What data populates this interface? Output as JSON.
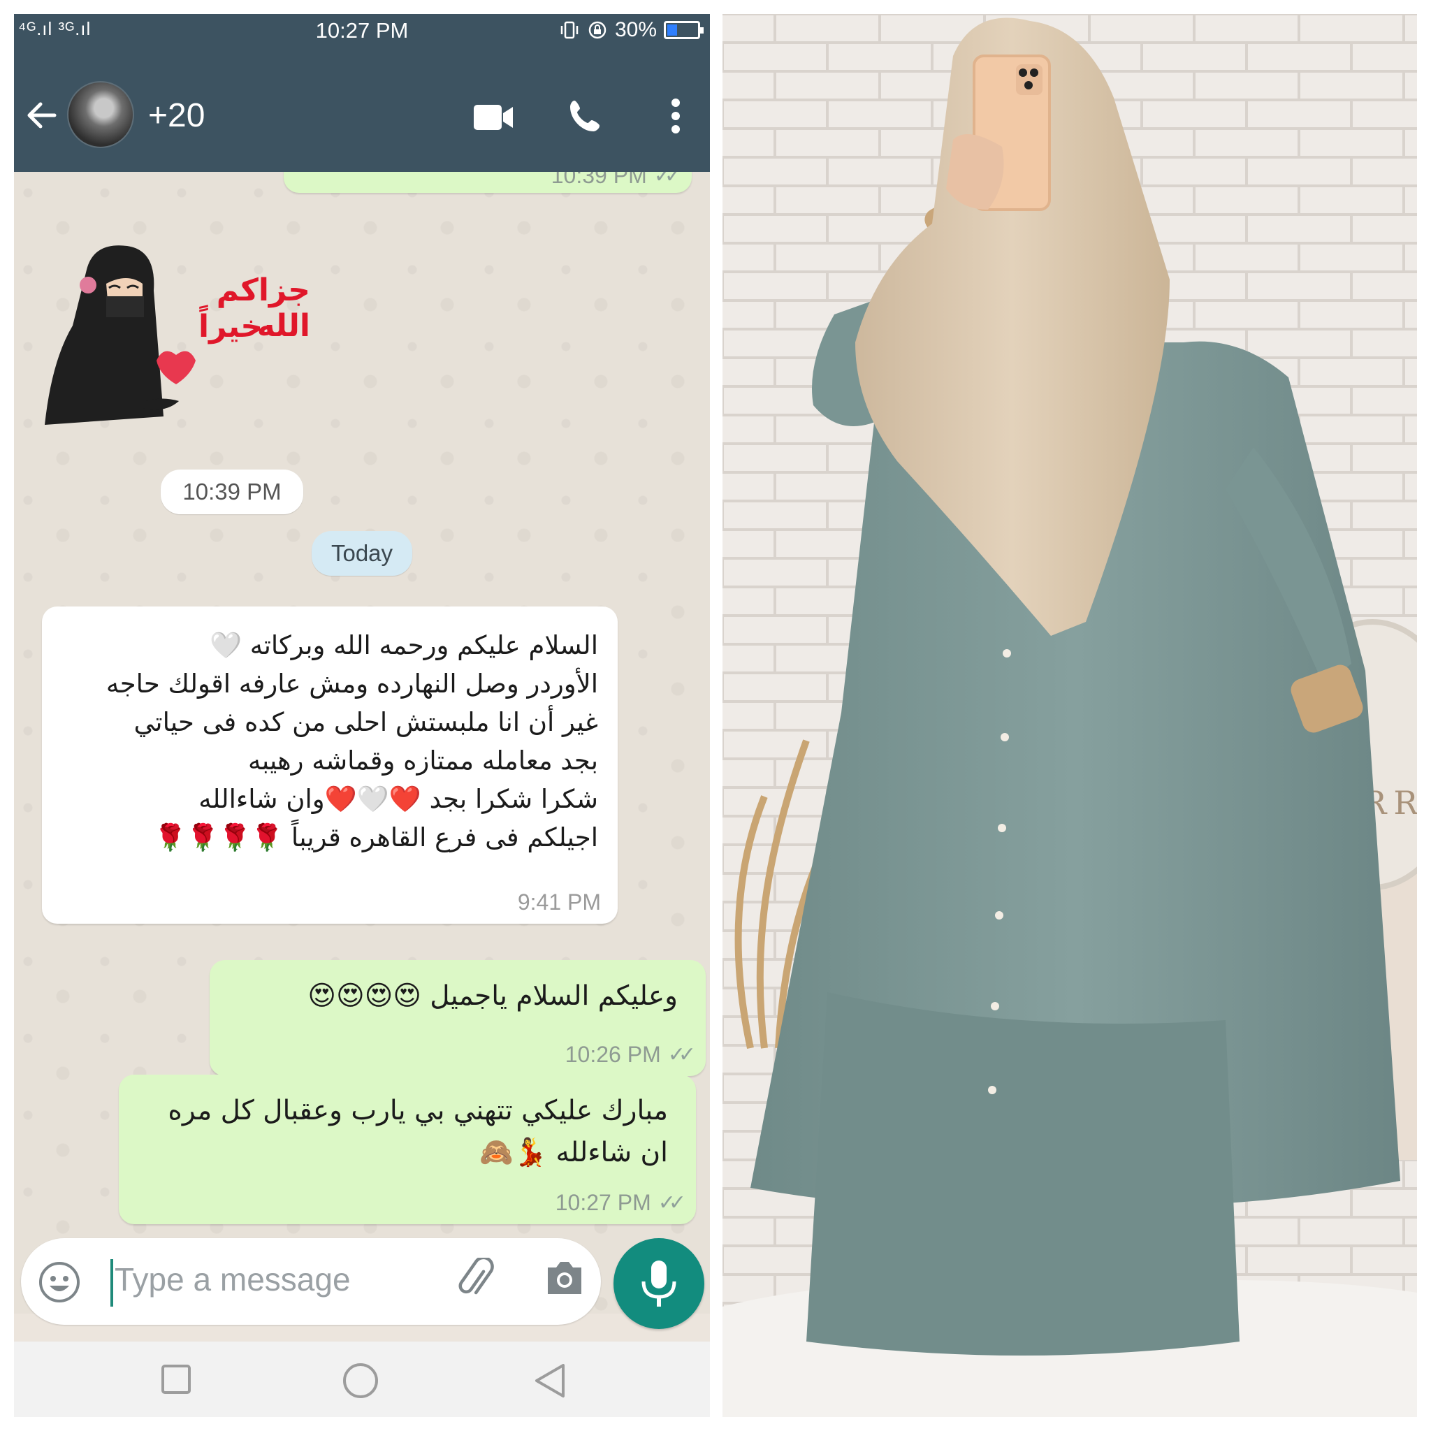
{
  "status_bar": {
    "signal": "⁴ᴳ.ıl ³ᴳ.ıl",
    "time": "10:27 PM",
    "battery": "30%",
    "battery_level": 0.3
  },
  "header": {
    "contact_name": "+20",
    "icons": [
      "back-arrow-icon",
      "video-call-icon",
      "phone-icon",
      "more-vert-icon"
    ]
  },
  "chat": {
    "top_partial_time": "10:39 PM",
    "sticker": {
      "line1": "جزاكم الله",
      "line2": "خيراً"
    },
    "time_chip": "10:39 PM",
    "date_chip": "Today",
    "messages": [
      {
        "direction": "incoming",
        "lines": [
          "السلام عليكم ورحمه الله وبركاته 🤍",
          "الأوردر وصل النهارده ومش عارفه اقولك حاجه",
          "غير أن انا ملبستش احلى من كده فى حياتي",
          "بجد معامله ممتازه وقماشه رهيبه",
          "شكرا شكرا بجد ❤️🤍❤️وان شاءالله",
          "اجيلكم فى فرع القاهره قريباً 🌹🌹🌹🌹"
        ],
        "time": "9:41 PM"
      },
      {
        "direction": "outgoing",
        "lines": [
          "وعليكم السلام ياجميل 😍😍😍😍"
        ],
        "time": "10:26 PM"
      },
      {
        "direction": "outgoing",
        "lines": [
          "مبارك عليكي تتهني بي يارب  وعقبال كل مره",
          "ان شاءلله 💃🙈"
        ],
        "time": "10:27 PM"
      }
    ]
  },
  "input": {
    "placeholder": "Type a message",
    "icons": [
      "emoji-icon",
      "attach-icon",
      "camera-icon",
      "mic-icon"
    ]
  },
  "nav_bar": {
    "icons": [
      "recents-square-icon",
      "home-circle-icon",
      "back-triangle-icon"
    ]
  },
  "photo": {
    "brand_sign_text": "ORR",
    "colors": {
      "dress": "#7f9a98",
      "khimar": "#d9c6ad",
      "wall": "#efebe7",
      "rug": "#f4f2ef",
      "phone_case": "#f2c9a6"
    }
  }
}
